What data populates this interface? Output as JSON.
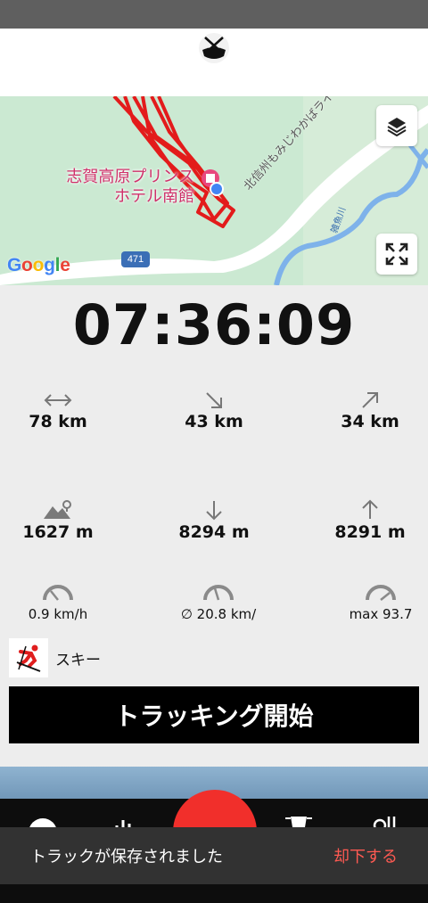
{
  "map": {
    "poi_label": "志賀高原プリンス\nホテル南館",
    "road_label": "北信州もみじわかばライン",
    "river_label": "雑魚川",
    "route_number": "471",
    "attribution_letters": [
      "G",
      "o",
      "o",
      "g",
      "l",
      "e"
    ],
    "track_color": "#e31b1b"
  },
  "timer": "07:36:09",
  "stats": {
    "distance_total": "78 km",
    "distance_down": "43 km",
    "distance_up": "34 km",
    "altitude": "1627 m",
    "descent": "8294 m",
    "ascent": "8291 m",
    "speed_min": "0.9 km/h",
    "speed_avg": "∅ 20.8 km/",
    "speed_max": "max 93.7"
  },
  "activity": {
    "label": "スキー",
    "icon": "skier-icon"
  },
  "start_button": "トラッキング開始",
  "snackbar": {
    "message": "トラックが保存されました",
    "action": "却下する"
  },
  "colors": {
    "accent": "#f12f2b",
    "snack_action": "#ff5a52"
  }
}
